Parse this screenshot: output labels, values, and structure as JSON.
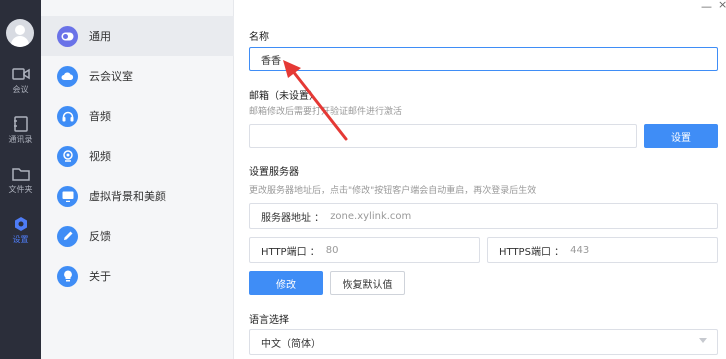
{
  "rail": {
    "items": [
      {
        "label": "会议"
      },
      {
        "label": "通讯录"
      },
      {
        "label": "文件夹"
      },
      {
        "label": "设置"
      }
    ]
  },
  "menu": {
    "items": [
      {
        "label": "通用",
        "icon": "toggle-icon",
        "active": true
      },
      {
        "label": "云会议室",
        "icon": "cloud-icon"
      },
      {
        "label": "音频",
        "icon": "headphones-icon"
      },
      {
        "label": "视频",
        "icon": "camera-icon"
      },
      {
        "label": "虚拟背景和美颜",
        "icon": "monitor-icon"
      },
      {
        "label": "反馈",
        "icon": "pencil-icon"
      },
      {
        "label": "关于",
        "icon": "lightbulb-icon"
      }
    ]
  },
  "window": {
    "minimize": "—",
    "close": "×"
  },
  "form": {
    "name_label": "名称",
    "name_value": "香香",
    "email_label": "邮箱（未设置）",
    "email_hint": "邮箱修改后需要打开验证邮件进行激活",
    "email_value": "",
    "email_button": "设置",
    "server_label": "设置服务器",
    "server_hint": "更改服务器地址后，点击\"修改\"按钮客户端会自动重启，再次登录后生效",
    "server_addr_key": "服务器地址 ：",
    "server_addr_value": "zone.xylink.com",
    "http_key": "HTTP端口 ：",
    "http_value": "80",
    "https_key": "HTTPS端口 ：",
    "https_value": "443",
    "modify_button": "修改",
    "restore_button": "恢复默认值",
    "lang_label": "语言选择",
    "lang_value": "中文（简体）"
  },
  "colors": {
    "accent": "#3f8df6",
    "rail_bg": "#2b2e3a",
    "menu_bg": "#f5f6f8",
    "arrow": "#e53935"
  }
}
